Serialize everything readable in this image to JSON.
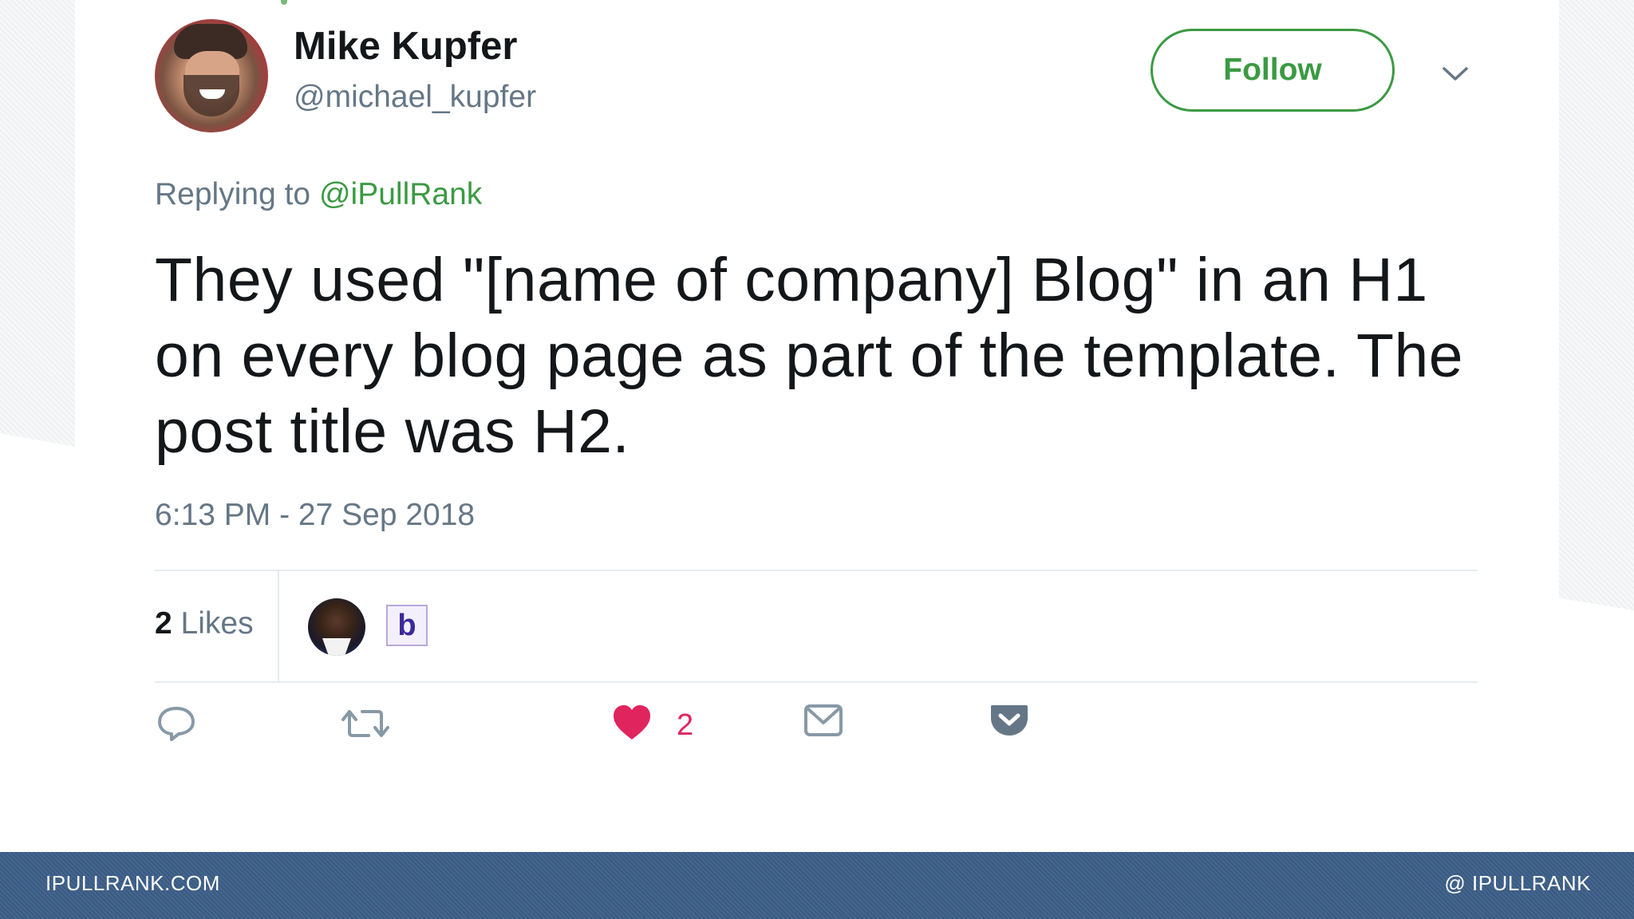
{
  "tweet": {
    "author_name": "Mike Kupfer",
    "author_handle": "@michael_kupfer",
    "follow_label": "Follow",
    "replying_prefix": "Replying to ",
    "replying_mention": "@iPullRank",
    "text": "They used \"[name of company] Blog\" in an H1 on every blog page as part of the template. The post title was H2.",
    "timestamp": "6:13 PM - 27 Sep 2018",
    "likes_count": "2",
    "likes_label": " Likes",
    "liker_badge_letter": "b",
    "actions": {
      "reply_icon": "reply-icon",
      "retweet_icon": "retweet-icon",
      "like_icon": "heart-icon",
      "like_count": "2",
      "dm_icon": "envelope-icon",
      "pocket_icon": "pocket-icon"
    }
  },
  "footer": {
    "left": "IPULLRANK.COM",
    "right": "@ IPULLRANK"
  },
  "colors": {
    "follow_green": "#3b9a43",
    "like_red": "#e0245e",
    "muted_gray": "#657786",
    "footer_blue": "#3f5f88"
  }
}
